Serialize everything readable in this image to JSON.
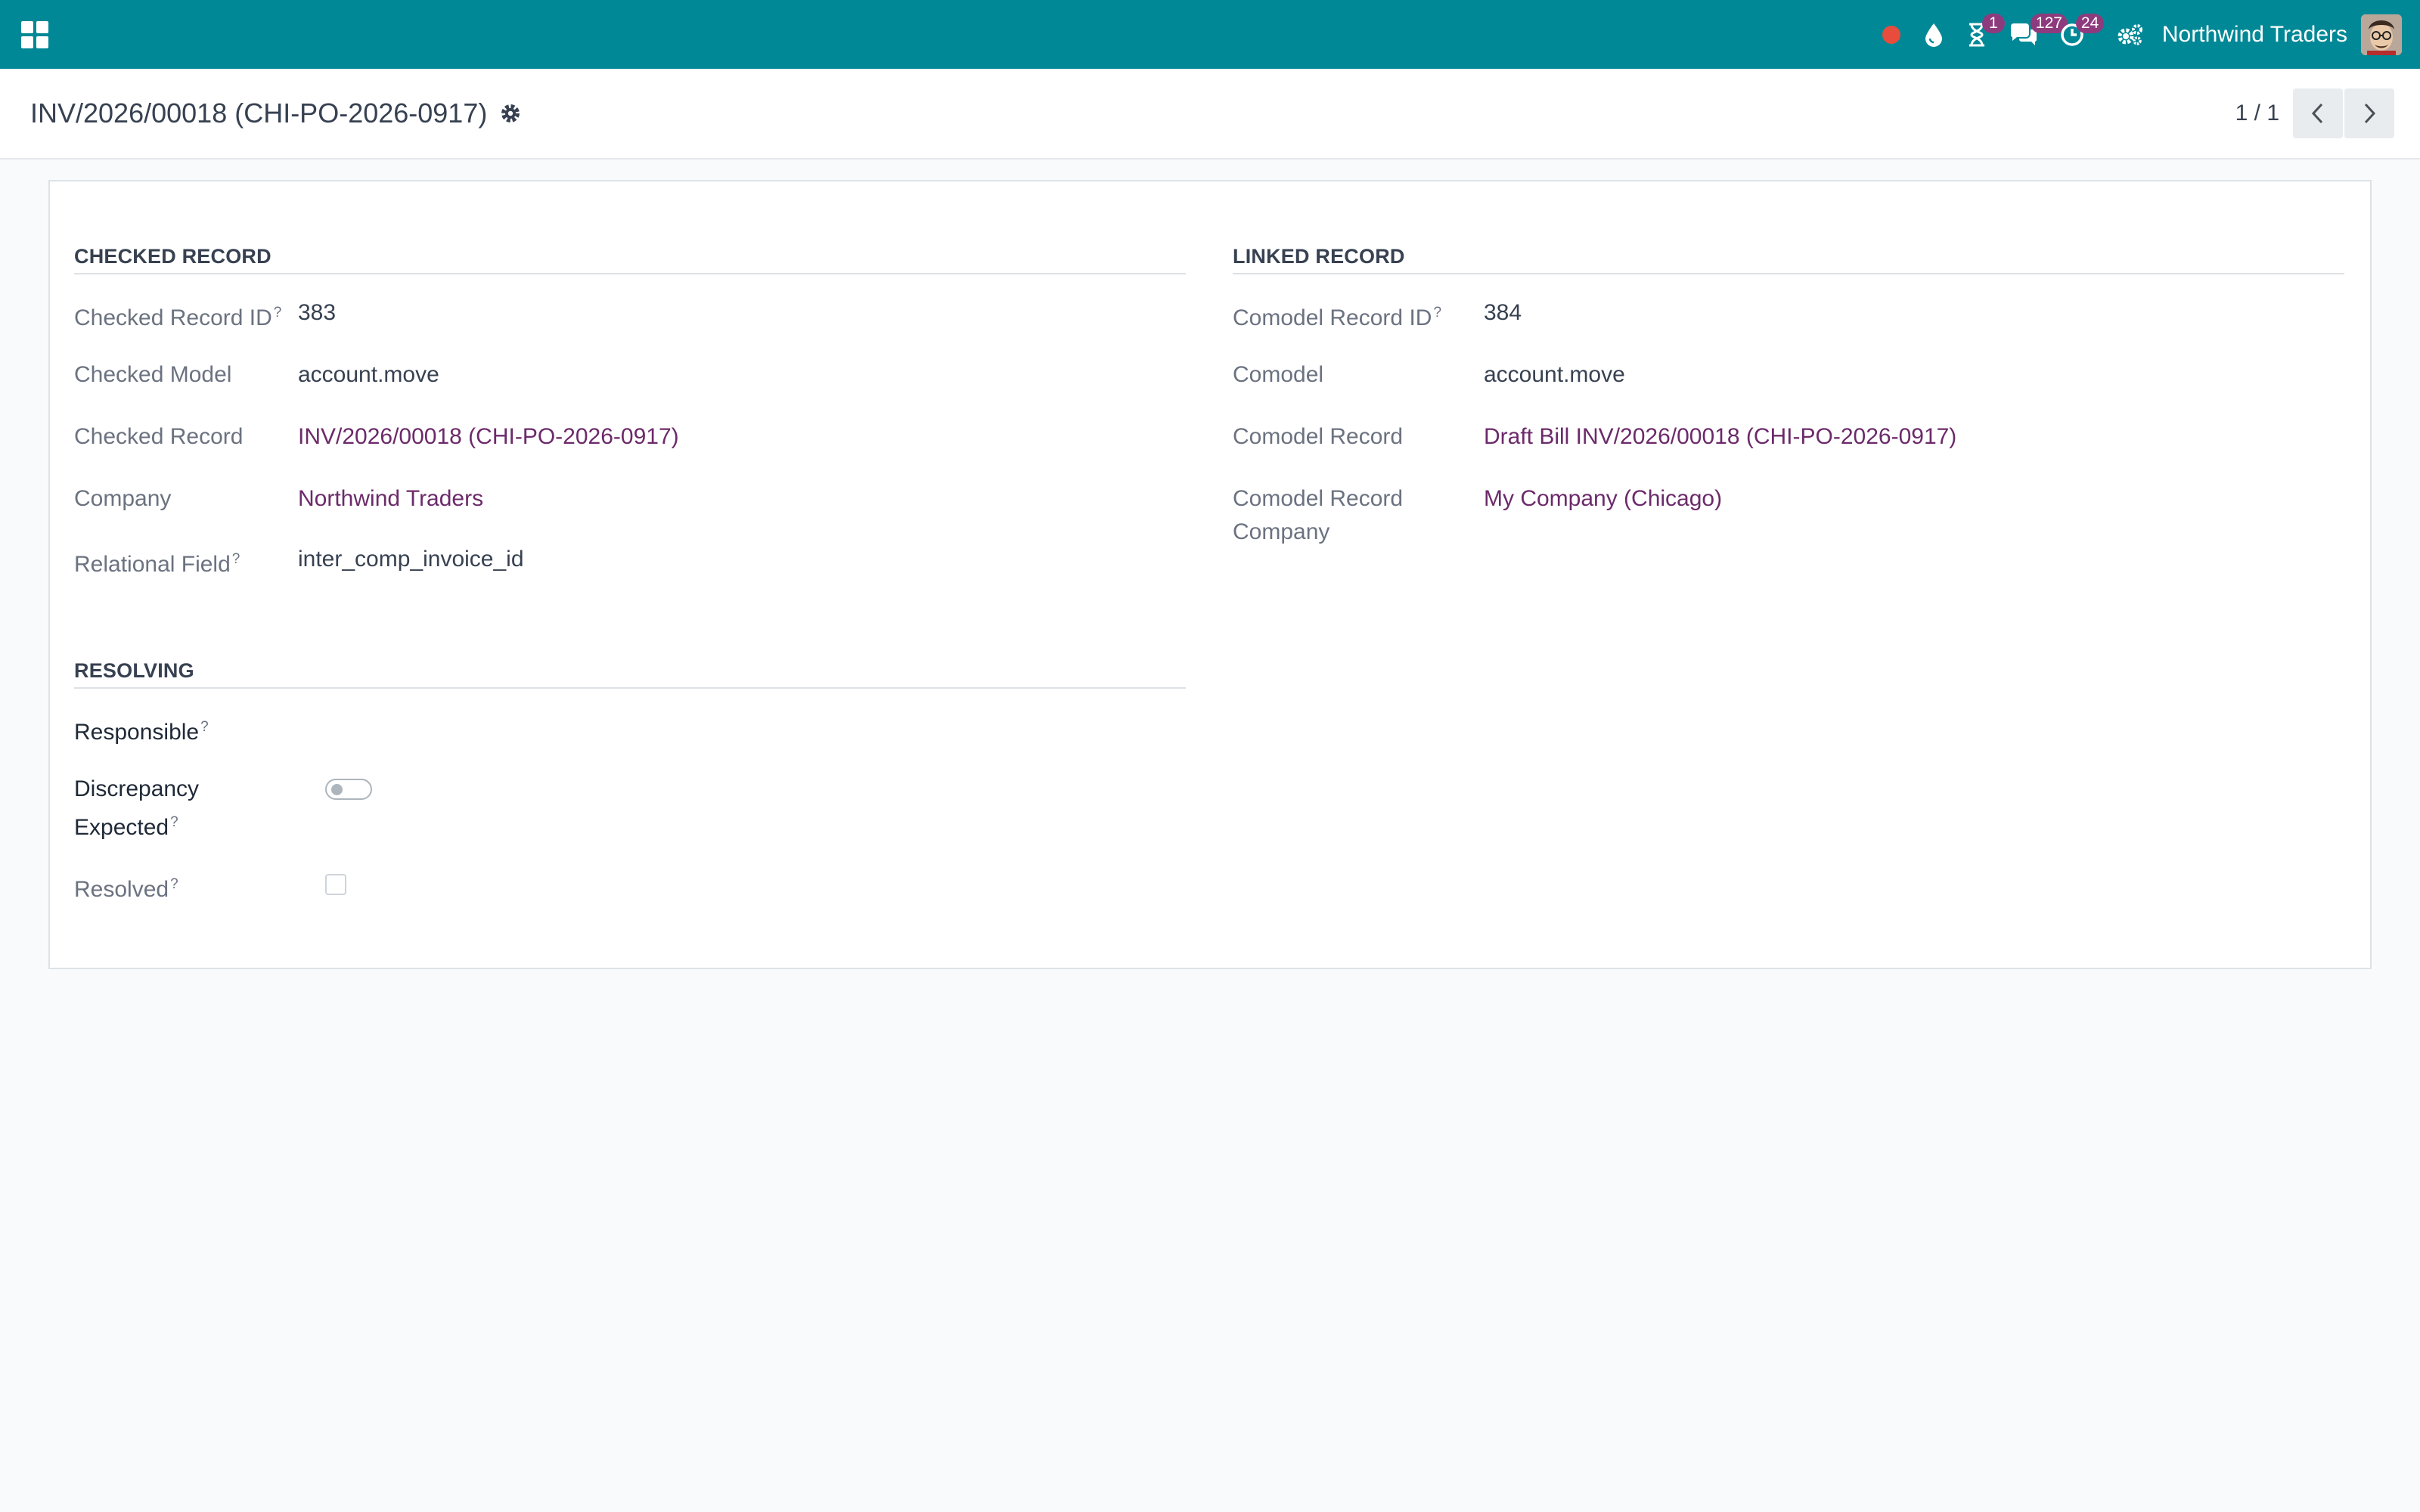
{
  "colors": {
    "navbar": "#008896",
    "link": "#6c2a6a",
    "badge": "#8e3b7e",
    "record_dot": "#e74c3c"
  },
  "navbar": {
    "apps_icon": "apps-grid-icon",
    "items": [
      {
        "name": "recording-dot-icon",
        "badge": ""
      },
      {
        "name": "droplet-icon",
        "badge": ""
      },
      {
        "name": "hourglass-icon",
        "badge": "1"
      },
      {
        "name": "chat-bubbles-icon",
        "badge": "127"
      },
      {
        "name": "clock-activity-icon",
        "badge": "24"
      },
      {
        "name": "cogs-icon",
        "badge": ""
      }
    ],
    "company": "Northwind Traders",
    "avatar": "user-avatar"
  },
  "control_panel": {
    "breadcrumb": "INV/2026/00018 (CHI-PO-2026-0917)",
    "pager_value": "1 / 1"
  },
  "checked": {
    "title": "CHECKED RECORD",
    "fields": [
      {
        "label": "Checked Record ID",
        "help": "?",
        "value": "383"
      },
      {
        "label": "Checked Model",
        "value": "account.move"
      },
      {
        "label": "Checked Record",
        "value": "INV/2026/00018 (CHI-PO-2026-0917)"
      },
      {
        "label": "Company",
        "value": "Northwind Traders"
      },
      {
        "label": "Relational Field",
        "help": "?",
        "value": "inter_comp_invoice_id"
      }
    ]
  },
  "linked": {
    "title": "LINKED RECORD",
    "fields": [
      {
        "label": "Comodel Record ID",
        "help": "?",
        "value": "384"
      },
      {
        "label": "Comodel",
        "value": "account.move"
      },
      {
        "label": "Comodel Record",
        "value": "Draft Bill INV/2026/00018 (CHI-PO-2026-0917)"
      },
      {
        "label_line1": "Comodel Record",
        "label_line2": "Company",
        "value": "My Company (Chicago)"
      }
    ]
  },
  "resolving": {
    "title": "RESOLVING",
    "responsible_label": "Responsible",
    "responsible_help": "?",
    "discrepancy_label_line1": "Discrepancy",
    "discrepancy_label_line2": "Expected",
    "discrepancy_help": "?",
    "discrepancy_expected": false,
    "resolved_label": "Resolved",
    "resolved_help": "?",
    "resolved": false
  }
}
